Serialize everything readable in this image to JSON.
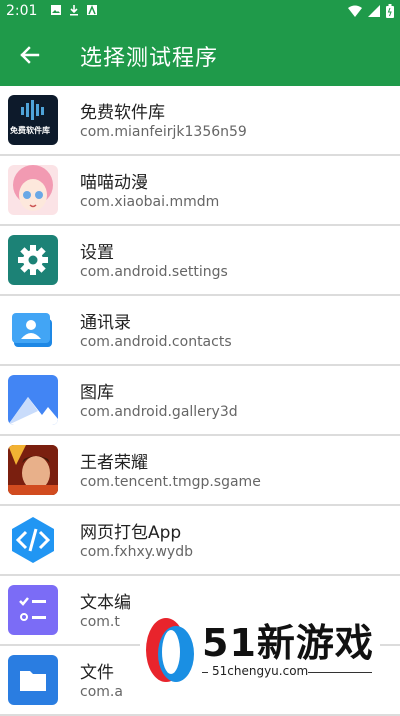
{
  "status": {
    "time": "2:01"
  },
  "appbar": {
    "title": "选择测试程序"
  },
  "apps": [
    {
      "name": "免费软件库",
      "package": "com.mianfeirjk1356n59",
      "logo_text": "免费软件库"
    },
    {
      "name": "喵喵动漫",
      "package": "com.xiaobai.mmdm"
    },
    {
      "name": "设置",
      "package": "com.android.settings"
    },
    {
      "name": "通讯录",
      "package": "com.android.contacts"
    },
    {
      "name": "图库",
      "package": "com.android.gallery3d"
    },
    {
      "name": "王者荣耀",
      "package": "com.tencent.tmgp.sgame"
    },
    {
      "name": "网页打包App",
      "package": "com.fxhxy.wydb"
    },
    {
      "name": "文本编",
      "package": "com.t"
    },
    {
      "name": "文件",
      "package": "com.a"
    }
  ],
  "watermark": {
    "text": "51新游戏",
    "url": "51chengyu.com"
  },
  "colors": {
    "primary": "#1f9a4a"
  }
}
